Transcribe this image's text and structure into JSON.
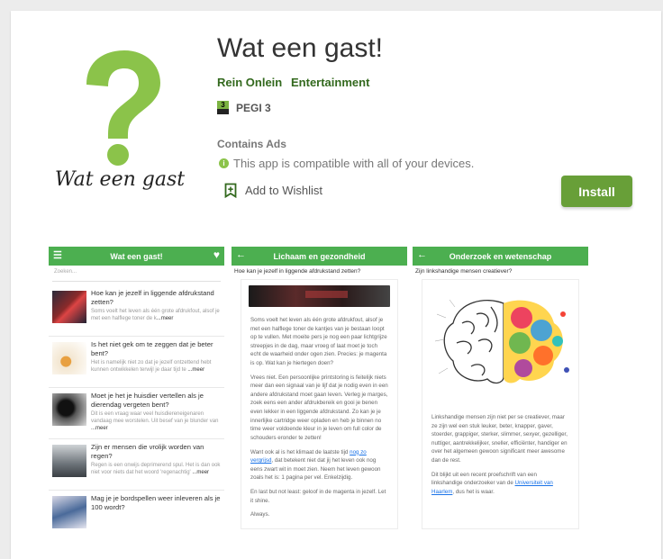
{
  "app": {
    "title": "Wat een gast!",
    "developer": "Rein Onlein",
    "category": "Entertainment",
    "rating_badge": "3",
    "rating": "PEGI 3",
    "contains_ads": "Contains Ads",
    "compatibility": "This app is compatible with all of your devices.",
    "wishlist_label": "Add to Wishlist",
    "install_label": "Install",
    "logo_text": "Wat een gast"
  },
  "colors": {
    "accent": "#689f38",
    "dev_link": "#33691e",
    "screenshot_bar": "#4caf50",
    "logo_question": "#8bc34a"
  },
  "screenshot1": {
    "bar_title": "Wat een gast!",
    "menu_icon": "hamburger-icon",
    "fav_icon": "heart-icon",
    "search_placeholder": "Zoeken...",
    "items": [
      {
        "title": "Hoe kan je jezelf in liggende afdrukstand zetten?",
        "body": "Soms voelt het leven als één grote afdrukfout, alsof je met een halflege toner de k",
        "more": "...meer"
      },
      {
        "title": "Is het niet gek om te zeggen dat je beter bent?",
        "body": "Het is namelijk niet zo dat je jezelf ontzettend hebt kunnen ontwikkelen terwijl je daar tijd te ",
        "more": "...meer"
      },
      {
        "title": "Moet je het je huisdier vertellen als je dierendag vergeten bent?",
        "body": "Dit is een vraag waar veel huisdiereneigenaren vandaag mee worstelen. Uit besef van je blunder van ",
        "more": "...meer"
      },
      {
        "title": "Zijn er mensen die vrolijk worden van regen?",
        "body": "Regen is een onwijs deprimerend spul. Het is dan ook niet voor niets dat het woord 'regenachtig' ",
        "more": "...meer"
      },
      {
        "title": "Mag je je bordspellen weer inleveren als je 100 wordt?",
        "body": "",
        "more": ""
      }
    ]
  },
  "screenshot2": {
    "bar_title": "Lichaam en gezondheid",
    "back_icon": "arrow-left-icon",
    "question": "Hoe kan je jezelf in liggende afdrukstand zetten?",
    "p1": "Soms voelt het leven als één grote afdrukfout, alsof je met een halflege toner de kantjes van je bestaan loopt op te vullen. Met moeite pers je nog een paar lichtgrijze streepjes in de dag, maar vroeg of laat moet je toch echt de waarheid onder ogen zien. Precies: je magenta is op. Wat kan je hiertegen doen?",
    "p2": "Vrees niet. Een persoonlijke printstoring is feitelijk niets meer dan een signaal van je lijf dat je nodig even in een andere afdrukstand moet gaan leven. Verleg je marges, zoek eens een ander afdrukbereik en gooi je benen even lekker in een liggende afdrukstand. Zo kan je je innerlijke cartridge weer opladen en heb je binnen no time weer voldoende kleur in je leven om full color de schouders eronder te zetten!",
    "p3_a": "Want ook al is het klimaat de laatste tijd ",
    "p3_link": "nog zo vergrijsd",
    "p3_b": ", dat betekent niet dat jij het leven ook nog eens zwart wit in moet zien. Neem het leven gewoon zoals het is: 1 pagina per vel. Enkelzijdig.",
    "p4": "En last but not least: geloof in de magenta in jezelf. Let it shine.",
    "p5": "Always."
  },
  "screenshot3": {
    "bar_title": "Onderzoek en wetenschap",
    "back_icon": "arrow-left-icon",
    "question": "Zijn linkshandige mensen creatiever?",
    "p1": "Linkshandige mensen zijn niet per se creatiever, maar ze zijn wel een stuk leuker, beter, knapper, gaver, stoerder, grappiger, sterker, slimmer, sexyer, gezelliger, nuttiger, aantrekkelijker, sneller, efficiënter, handiger en over het algemeen gewoon significant meer awesome dan de rest.",
    "p2_a": "Dit blijkt uit een recent proefschrift van een linkshandige onderzoeker van de ",
    "p2_link": "Universiteit van Haarlem",
    "p2_b": ", dus het is waar."
  }
}
